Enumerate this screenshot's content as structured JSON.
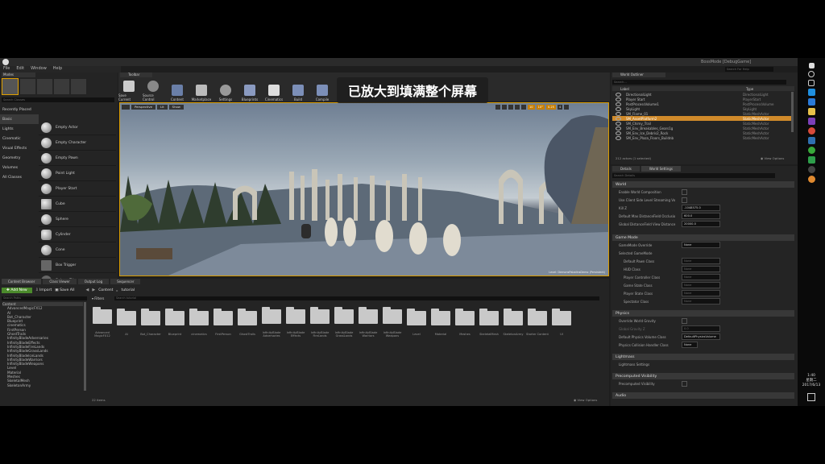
{
  "overlay_caption": "已放大到填满整个屏幕",
  "window": {
    "title": "BossMode [DebugGame]",
    "search_placeholder": "Search For Help"
  },
  "menu": [
    "File",
    "Edit",
    "Window",
    "Help"
  ],
  "modes": {
    "title": "Modes",
    "search_placeholder": "Search Classes",
    "categories": [
      "Recently Placed",
      "Basic",
      "Lights",
      "Cinematic",
      "Visual Effects",
      "Geometry",
      "Volumes",
      "All Classes"
    ],
    "items": [
      "Empty Actor",
      "Empty Character",
      "Empty Pawn",
      "Point Light",
      "Player Start",
      "Cube",
      "Sphere",
      "Cylinder",
      "Cone",
      "Box Trigger",
      "Sphere Trigger"
    ]
  },
  "toolbar": {
    "tab": "Toolbar",
    "buttons": [
      "Save Current",
      "Source Control",
      "Content",
      "Marketplace",
      "Settings",
      "Blueprints",
      "Cinematics",
      "Build",
      "Compile"
    ]
  },
  "viewport": {
    "perspective": "Perspective",
    "lit": "Lit",
    "show": "Show",
    "grid": "10",
    "angle": "10°",
    "scale": "0.25",
    "cam": "4",
    "level_label": "Level: DemonsPaladinsDemo (Persistent)"
  },
  "content_browser": {
    "tabs": [
      "Content Browser",
      "Class Viewer",
      "Output Log",
      "Sequencer"
    ],
    "add_new": "Add New",
    "import": "Import",
    "save_all": "Save All",
    "path": [
      "Content",
      "tutorial"
    ],
    "filters": "Filters",
    "search_paths": "Search Paths",
    "search_placeholder": "Search tutorial",
    "tree": [
      "Content",
      "AdvancedMagicFX12",
      "AI",
      "Bot_Character",
      "Blueprint",
      "cinematics",
      "FirstPerson",
      "GhostTrails",
      "InfinityBladeAdversaries",
      "InfinityBladeEffects",
      "InfinityBladeFireLands",
      "InfinityBladeGrassLands",
      "InfinityBladeIceLands",
      "InfinityBladeWarriors",
      "InfinityBladeWeapons",
      "Level",
      "Material",
      "Meshes",
      "SkeletalMesh",
      "SkeletonArmy"
    ],
    "folders": [
      "Advanced MagicFX12",
      "AI",
      "Bot_Character",
      "Blueprint",
      "cinematics",
      "FirstPerson",
      "GhostTrails",
      "InfinityBlade Adversaries",
      "InfinityBlade Effects",
      "InfinityBlade FireLands",
      "InfinityBlade GrassLands",
      "InfinityBlade Warriors",
      "InfinityBlade Weapons",
      "Level",
      "Material",
      "Meshes",
      "SkeletalMesh",
      "SkeletonArmy",
      "Starter Content",
      "UI"
    ],
    "count": "22 items",
    "view_options": "View Options"
  },
  "outliner": {
    "title": "World Outliner",
    "search_placeholder": "Search...",
    "col_label": "Label",
    "col_type": "Type",
    "rows": [
      {
        "label": "DirectionalLight",
        "type": "DirectionalLight"
      },
      {
        "label": "Player Start",
        "type": "PlayerStart"
      },
      {
        "label": "PostProcessVolume1",
        "type": "PostProcessVolume"
      },
      {
        "label": "SkyLight",
        "type": "SkyLight"
      },
      {
        "label": "SM_Flame_01",
        "type": "StaticMeshActor"
      },
      {
        "label": "SM_AssetPlatform2",
        "type": "StaticMeshActor"
      },
      {
        "label": "SM_Chimy_Trail",
        "type": "StaticMeshActor"
      },
      {
        "label": "SM_Env_Breakables_Gears1g",
        "type": "StaticMeshActor"
      },
      {
        "label": "SM_Env_Ice_Debris2_Rock",
        "type": "StaticMeshActor"
      },
      {
        "label": "SM_Env_Plaza_Floors_Buildnb",
        "type": "StaticMeshActor"
      }
    ],
    "selected_index": 5,
    "footer": "212 actors (1 selected)",
    "view_options": "View Options"
  },
  "details": {
    "tabs": [
      "Details",
      "World Settings"
    ],
    "search_placeholder": "Search Details",
    "sections": [
      {
        "title": "World",
        "props": [
          {
            "name": "Enable World Composition",
            "kind": "check"
          },
          {
            "name": "Use Client Side Level Streaming Vo",
            "kind": "check"
          },
          {
            "name": "Kill Z",
            "value": "-1048575.0"
          },
          {
            "name": "Default Max DistanceField Occlusio",
            "value": "600.0"
          },
          {
            "name": "Global DistanceField View Distance",
            "value": "20000.0"
          }
        ]
      },
      {
        "title": "Game Mode",
        "props": [
          {
            "name": "GameMode Override",
            "value": "None"
          },
          {
            "name": "Selected GameMode",
            "value": ""
          },
          {
            "name": "Default Pawn Class",
            "value": "None"
          },
          {
            "name": "HUD Class",
            "value": "None"
          },
          {
            "name": "Player Controller Class",
            "value": "None"
          },
          {
            "name": "Game State Class",
            "value": "None"
          },
          {
            "name": "Player State Class",
            "value": "None"
          },
          {
            "name": "Spectator Class",
            "value": "None"
          }
        ]
      },
      {
        "title": "Physics",
        "props": [
          {
            "name": "Override World Gravity",
            "kind": "check"
          },
          {
            "name": "Global Gravity Z",
            "value": "0.0"
          },
          {
            "name": "Default Physics Volume Class",
            "value": "DefaultPhysicsVolume"
          },
          {
            "name": "Physics Collision Handler Class",
            "value": "None"
          }
        ]
      },
      {
        "title": "Lightmass",
        "props": [
          {
            "name": "Lightmass Settings",
            "value": ""
          }
        ]
      },
      {
        "title": "Precomputed Visibility",
        "props": [
          {
            "name": "Precomputed Visibility",
            "kind": "check"
          }
        ]
      },
      {
        "title": "Audio",
        "props": []
      }
    ]
  },
  "taskbar": {
    "time": "1:40",
    "day": "星期二",
    "date": "2017/6/13"
  }
}
